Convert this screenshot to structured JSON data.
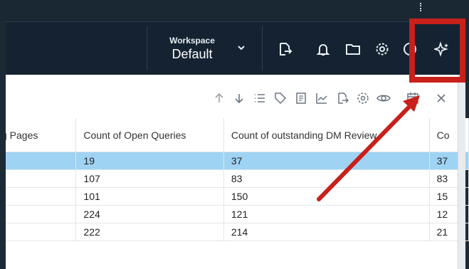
{
  "header": {
    "workspace_label": "Workspace",
    "workspace_value": "Default",
    "icons": [
      "export-icon",
      "bell-icon",
      "folder-icon",
      "settings-icon",
      "help-icon",
      "ai-sparkle-icon"
    ]
  },
  "toolbar": {
    "icons": [
      "sort-ascending-icon",
      "sort-descending-icon",
      "list-icon",
      "tag-icon",
      "notes-icon",
      "chart-icon",
      "export-icon",
      "settings-icon",
      "view-icon",
      "calendar-icon",
      "close-icon"
    ]
  },
  "table": {
    "columns": [
      "g Pages",
      "Count of Open Queries",
      "Count of outstanding DM Review",
      "Co"
    ],
    "rows": [
      [
        "",
        "19",
        "37",
        "37"
      ],
      [
        "",
        "107",
        "83",
        "83"
      ],
      [
        "",
        "101",
        "150",
        "15"
      ],
      [
        "",
        "224",
        "121",
        "12"
      ],
      [
        "",
        "222",
        "214",
        "21"
      ]
    ],
    "selected_row": 0
  },
  "colors": {
    "header_bg": "#142231",
    "highlight": "#c8201b",
    "selected_row": "#9fd3f4"
  }
}
